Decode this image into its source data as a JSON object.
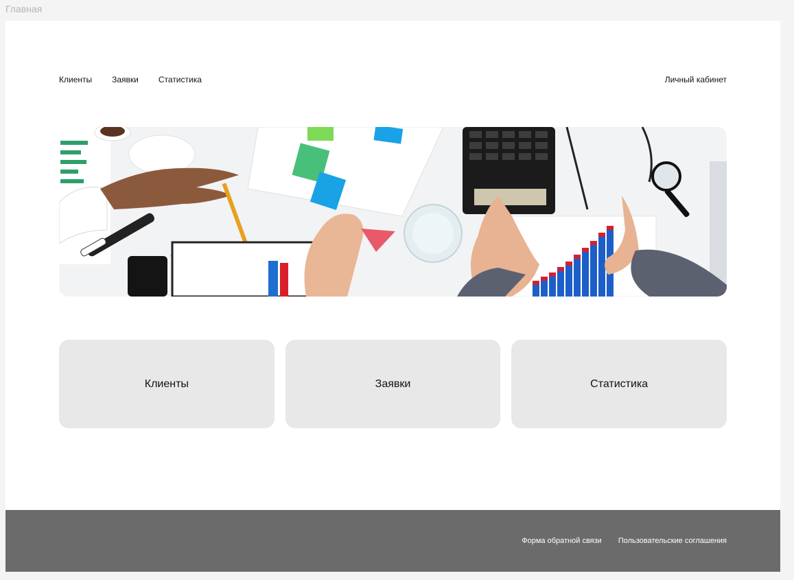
{
  "frame": {
    "title": "Главная"
  },
  "nav": {
    "items": [
      {
        "label": "Клиенты"
      },
      {
        "label": "Заявки"
      },
      {
        "label": "Статистика"
      }
    ],
    "account_label": "Личный кабинет"
  },
  "hero": {
    "image_description": "office-desk-teamwork-photo"
  },
  "cards": [
    {
      "label": "Клиенты"
    },
    {
      "label": "Заявки"
    },
    {
      "label": "Статистика"
    }
  ],
  "footer": {
    "links": [
      {
        "label": "Форма обратной связи"
      },
      {
        "label": "Пользовательские соглашения"
      }
    ]
  },
  "colors": {
    "page_bg": "#f4f4f4",
    "card_bg": "#e8e8e8",
    "footer_bg": "#6b6b6b"
  }
}
